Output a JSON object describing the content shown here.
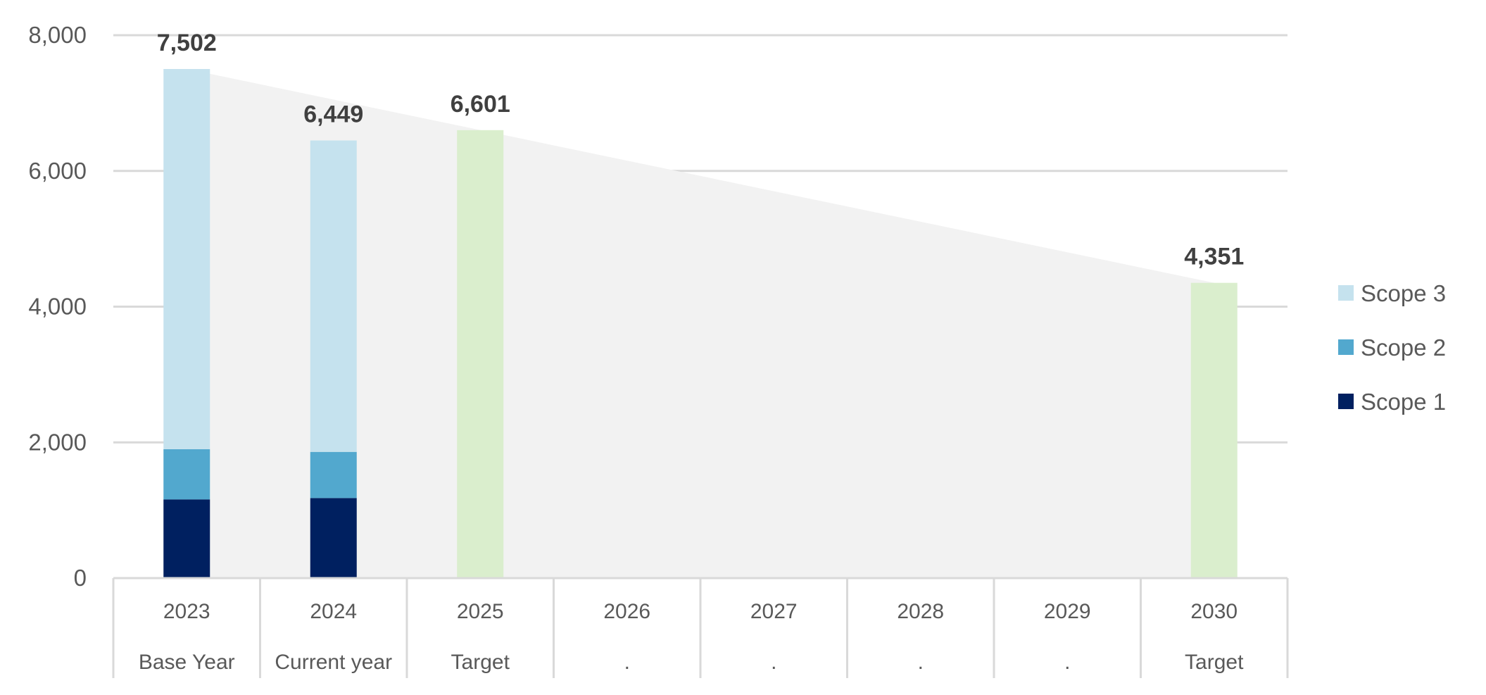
{
  "chart_data": {
    "type": "bar",
    "stacked": true,
    "title": "",
    "xlabel": "",
    "ylabel": "",
    "ylim": [
      0,
      8000
    ],
    "yticks": [
      0,
      2000,
      4000,
      6000,
      8000
    ],
    "ytick_labels": [
      "0",
      "2,000",
      "4,000",
      "6,000",
      "8,000"
    ],
    "grid": true,
    "categories": [
      "2023",
      "2024",
      "2025",
      "2026",
      "2027",
      "2028",
      "2029",
      "2030"
    ],
    "category_sublabels": [
      "Base Year",
      "Current year",
      "Target",
      ".",
      ".",
      ".",
      ".",
      "Target"
    ],
    "series": [
      {
        "name": "Scope 1",
        "color": "#002060",
        "values": [
          1160,
          1180,
          null,
          null,
          null,
          null,
          null,
          null
        ]
      },
      {
        "name": "Scope 2",
        "color": "#52A8CE",
        "values": [
          740,
          680,
          null,
          null,
          null,
          null,
          null,
          null
        ]
      },
      {
        "name": "Scope 3",
        "color": "#C5E2EE",
        "values": [
          5602,
          4589,
          null,
          null,
          null,
          null,
          null,
          null
        ]
      },
      {
        "name": "Target",
        "color": "#DAEECD",
        "values": [
          null,
          null,
          6601,
          null,
          null,
          null,
          null,
          4351
        ],
        "in_legend": false
      }
    ],
    "trend_area": {
      "color": "#F2F2F2",
      "from": {
        "category": "2023",
        "value": 7502
      },
      "to": {
        "category": "2030",
        "value": 4351
      }
    },
    "data_labels": [
      {
        "category": "2023",
        "value": 7502,
        "text": "7,502"
      },
      {
        "category": "2024",
        "value": 6449,
        "text": "6,449"
      },
      {
        "category": "2025",
        "value": 6601,
        "text": "6,601"
      },
      {
        "category": "2030",
        "value": 4351,
        "text": "4,351"
      }
    ],
    "legend": {
      "placement": "right",
      "entries": [
        {
          "name": "Scope 3",
          "color": "#C5E2EE"
        },
        {
          "name": "Scope 2",
          "color": "#52A8CE"
        },
        {
          "name": "Scope 1",
          "color": "#002060"
        }
      ]
    },
    "colors": {
      "gridline": "#D9D9D9",
      "axis_text": "#595959",
      "label_text": "#404040"
    }
  }
}
